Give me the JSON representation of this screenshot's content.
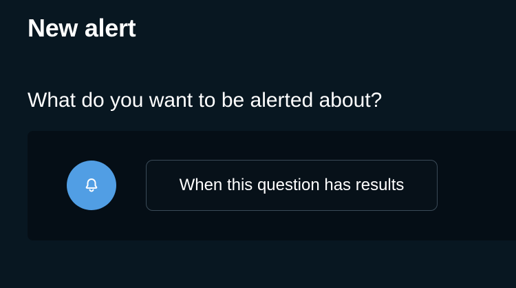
{
  "header": {
    "title": "New alert"
  },
  "section": {
    "question": "What do you want to be alerted about?"
  },
  "alert_card": {
    "icon": "bell-icon",
    "icon_bg_color": "#519ee4",
    "option_label": "When this question has results"
  },
  "colors": {
    "background": "#081721",
    "card_background": "#050e16",
    "accent": "#519ee4",
    "border": "#3b4b58"
  }
}
